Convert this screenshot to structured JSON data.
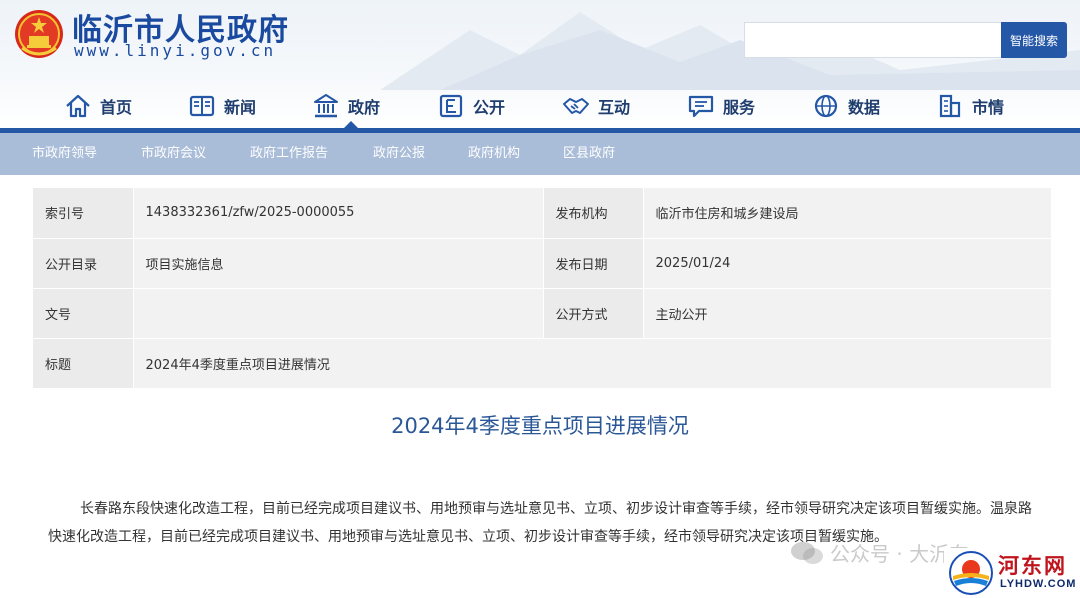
{
  "header": {
    "site_name": "临沂市人民政府",
    "site_url": "www.linyi.gov.cn",
    "search_placeholder": "",
    "search_button": "智能搜索",
    "brand_color": "#2557a7"
  },
  "main_nav": [
    {
      "label": "首页",
      "icon": "home-icon"
    },
    {
      "label": "新闻",
      "icon": "newspaper-icon"
    },
    {
      "label": "政府",
      "icon": "government-building-icon"
    },
    {
      "label": "公开",
      "icon": "disclosure-icon"
    },
    {
      "label": "互动",
      "icon": "handshake-icon"
    },
    {
      "label": "服务",
      "icon": "service-chat-icon"
    },
    {
      "label": "数据",
      "icon": "data-globe-icon"
    },
    {
      "label": "市情",
      "icon": "city-building-icon"
    }
  ],
  "active_nav": "政府",
  "sub_nav": [
    "市政府领导",
    "市政府会议",
    "政府工作报告",
    "政府公报",
    "政府机构",
    "区县政府"
  ],
  "info": {
    "index_label": "索引号",
    "index_value": "1438332361/zfw/2025-0000055",
    "publisher_label": "发布机构",
    "publisher_value": "临沂市住房和城乡建设局",
    "catalog_label": "公开目录",
    "catalog_value": "项目实施信息",
    "date_label": "发布日期",
    "date_value": "2025/01/24",
    "docno_label": "文号",
    "docno_value": "",
    "method_label": "公开方式",
    "method_value": "主动公开",
    "title_label": "标题",
    "title_value": "2024年4季度重点项目进展情况"
  },
  "document": {
    "title": "2024年4季度重点项目进展情况",
    "body": "长春路东段快速化改造工程，目前已经完成项目建议书、用地预审与选址意见书、立项、初步设计审查等手续，经市领导研究决定该项目暂缓实施。温泉路快速化改造工程，目前已经完成项目建议书、用地预审与选址意见书、立项、初步设计审查等手续，经市领导研究决定该项目暂缓实施。"
  },
  "watermark": {
    "text": "公众号 · 大沂东"
  },
  "corner_logo": {
    "cn": "河东网",
    "en": "LYHDW.COM"
  }
}
